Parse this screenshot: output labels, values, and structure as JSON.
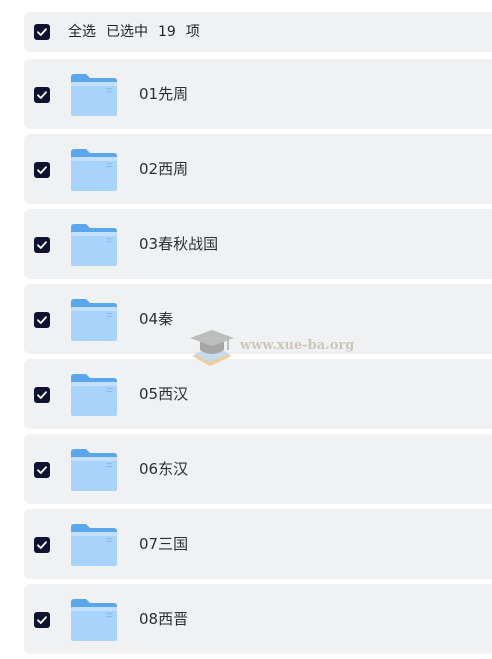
{
  "header": {
    "select_all_label": "全选",
    "selected_prefix": "已选中",
    "selected_count": "19",
    "selected_suffix": "项",
    "checked": true
  },
  "folders": [
    {
      "name": "01先周",
      "checked": true
    },
    {
      "name": "02西周",
      "checked": true
    },
    {
      "name": "03春秋战国",
      "checked": true
    },
    {
      "name": "04秦",
      "checked": true
    },
    {
      "name": "05西汉",
      "checked": true
    },
    {
      "name": "06东汉",
      "checked": true
    },
    {
      "name": "07三国",
      "checked": true
    },
    {
      "name": "08西晋",
      "checked": true
    }
  ],
  "watermark": {
    "text": "www.xue-ba.org"
  },
  "colors": {
    "row_background": "#f0f1f3",
    "checkbox_fill": "#0f1230",
    "folder_front": "#a8d4fb",
    "folder_back": "#5aa7ee"
  }
}
